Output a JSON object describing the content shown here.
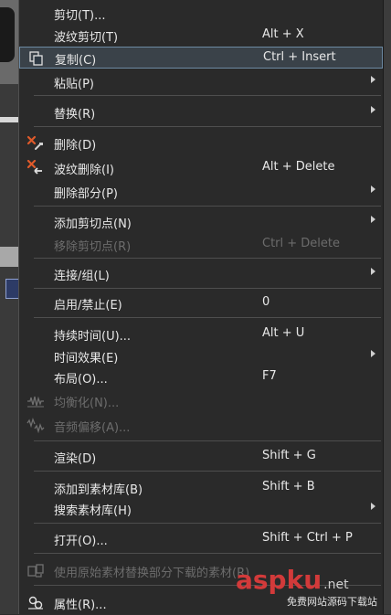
{
  "menu": {
    "items": [
      {
        "label": "剪切(T)...",
        "shortcut": "",
        "submenu": false,
        "disabled": false
      },
      {
        "label": "波纹剪切(T)",
        "shortcut": "Alt + X",
        "submenu": false,
        "disabled": false
      },
      {
        "label": "复制(C)",
        "shortcut": "Ctrl + Insert",
        "submenu": false,
        "disabled": false,
        "selected": true
      },
      {
        "label": "粘贴(P)",
        "shortcut": "",
        "submenu": true,
        "disabled": false
      },
      {
        "label": "替换(R)",
        "shortcut": "",
        "submenu": true,
        "disabled": false
      },
      {
        "label": "删除(D)",
        "shortcut": "",
        "submenu": false,
        "disabled": false
      },
      {
        "label": "波纹删除(I)",
        "shortcut": "Alt + Delete",
        "submenu": false,
        "disabled": false
      },
      {
        "label": "删除部分(P)",
        "shortcut": "",
        "submenu": true,
        "disabled": false
      },
      {
        "label": "添加剪切点(N)",
        "shortcut": "",
        "submenu": true,
        "disabled": false
      },
      {
        "label": "移除剪切点(R)",
        "shortcut": "Ctrl + Delete",
        "submenu": false,
        "disabled": true
      },
      {
        "label": "连接/组(L)",
        "shortcut": "",
        "submenu": true,
        "disabled": false
      },
      {
        "label": "启用/禁止(E)",
        "shortcut": "0",
        "submenu": false,
        "disabled": false
      },
      {
        "label": "持续时间(U)...",
        "shortcut": "Alt + U",
        "submenu": false,
        "disabled": false
      },
      {
        "label": "时间效果(E)",
        "shortcut": "",
        "submenu": true,
        "disabled": false
      },
      {
        "label": "布局(O)...",
        "shortcut": "F7",
        "submenu": false,
        "disabled": false
      },
      {
        "label": "均衡化(N)...",
        "shortcut": "",
        "submenu": false,
        "disabled": true
      },
      {
        "label": "音频偏移(A)...",
        "shortcut": "",
        "submenu": false,
        "disabled": true
      },
      {
        "label": "渲染(D)",
        "shortcut": "Shift + G",
        "submenu": false,
        "disabled": false
      },
      {
        "label": "添加到素材库(B)",
        "shortcut": "Shift + B",
        "submenu": false,
        "disabled": false
      },
      {
        "label": "搜索素材库(H)",
        "shortcut": "",
        "submenu": true,
        "disabled": false
      },
      {
        "label": "打开(O)...",
        "shortcut": "Shift + Ctrl + P",
        "submenu": false,
        "disabled": false
      },
      {
        "label": "使用原始素材替换部分下载的素材(R)",
        "shortcut": "",
        "submenu": false,
        "disabled": true
      },
      {
        "label": "属性(R)...",
        "shortcut": "",
        "submenu": false,
        "disabled": false
      }
    ]
  },
  "icons": {
    "copy": "copy-icon",
    "delete": "delete-icon",
    "ripple_delete": "ripple-delete-icon",
    "equalize": "equalize-icon",
    "audio_offset": "audio-offset-icon",
    "replace_source": "replace-source-icon",
    "properties": "properties-icon"
  },
  "colors": {
    "menu_bg": "#2a2a2a",
    "selection_border": "#6d8aa3",
    "text": "#e8e8e8",
    "disabled_text": "#6c6c6c",
    "watermark_red": "#d23a3a"
  },
  "watermark": {
    "brand": "aspku",
    "suffix": ".net",
    "tagline": "免费网站源码下载站"
  }
}
